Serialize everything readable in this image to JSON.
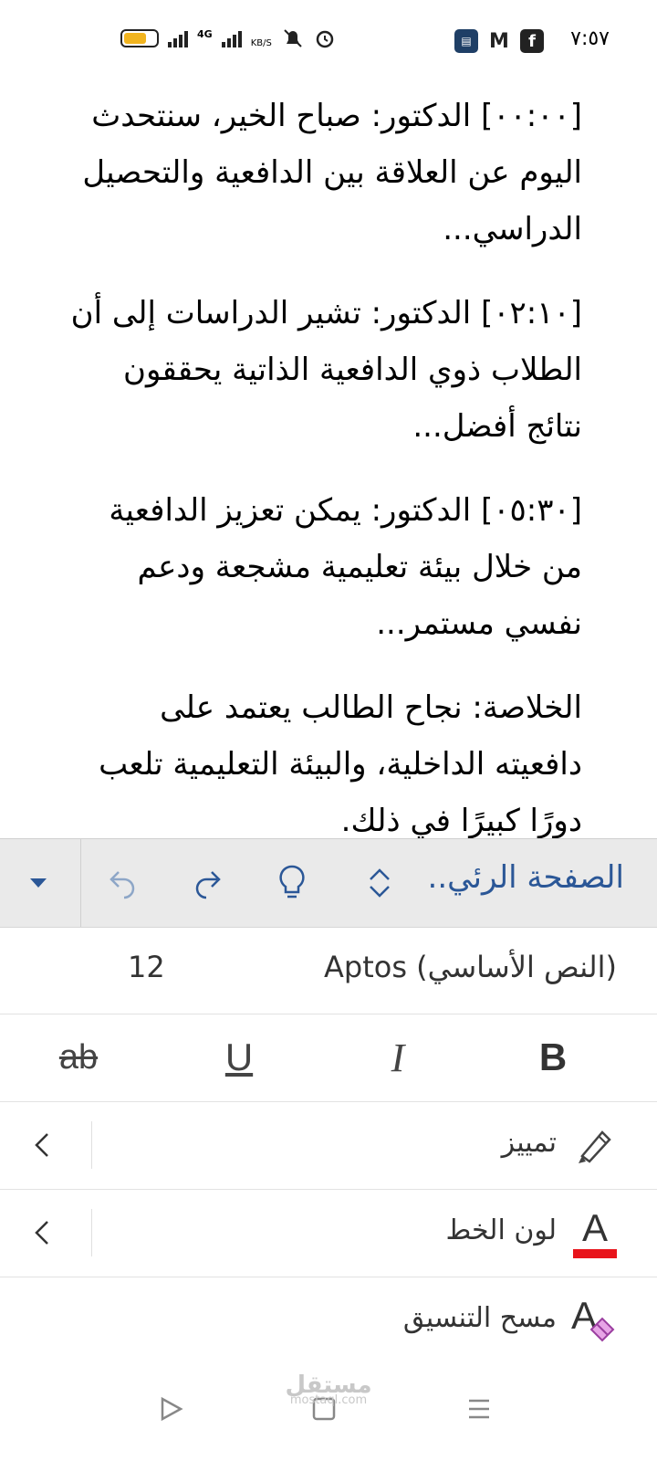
{
  "status_bar": {
    "time": "٧:٥٧",
    "network_label": "4G",
    "speed_unit": "KB/S"
  },
  "document": {
    "paragraphs": [
      "[٠٠:٠٠] الدكتور: صباح الخير، سنتحدث اليوم عن العلاقة بين الدافعية والتحصيل الدراسي...",
      "[٠٢:١٠] الدكتور: تشير الدراسات إلى أن الطلاب ذوي الدافعية الذاتية يحققون نتائج أفضل...",
      "[٠٥:٣٠] الدكتور: يمكن تعزيز الدافعية من خلال بيئة تعليمية مشجعة ودعم نفسي مستمر...",
      "الخلاصة: نجاح الطالب يعتمد على دافعيته الداخلية، والبيئة التعليمية تلعب دورًا كبيرًا في ذلك."
    ]
  },
  "ribbon": {
    "tab_label": "الصفحة الرئي..",
    "accent_color": "#2b5797"
  },
  "format_panel": {
    "font_name": "(النص الأساسي) Aptos",
    "font_size": "12",
    "bold": "B",
    "italic": "I",
    "underline": "U",
    "strikethrough": "ab",
    "highlight_label": "تمييز",
    "font_color_label": "لون الخط",
    "font_color_icon_letter": "A",
    "font_color_value": "#e8141b",
    "clear_format_label": "مسح التنسيق",
    "clear_format_icon_letter": "A"
  },
  "watermark": {
    "brand": "مستقل",
    "domain": "mostaql.com"
  }
}
